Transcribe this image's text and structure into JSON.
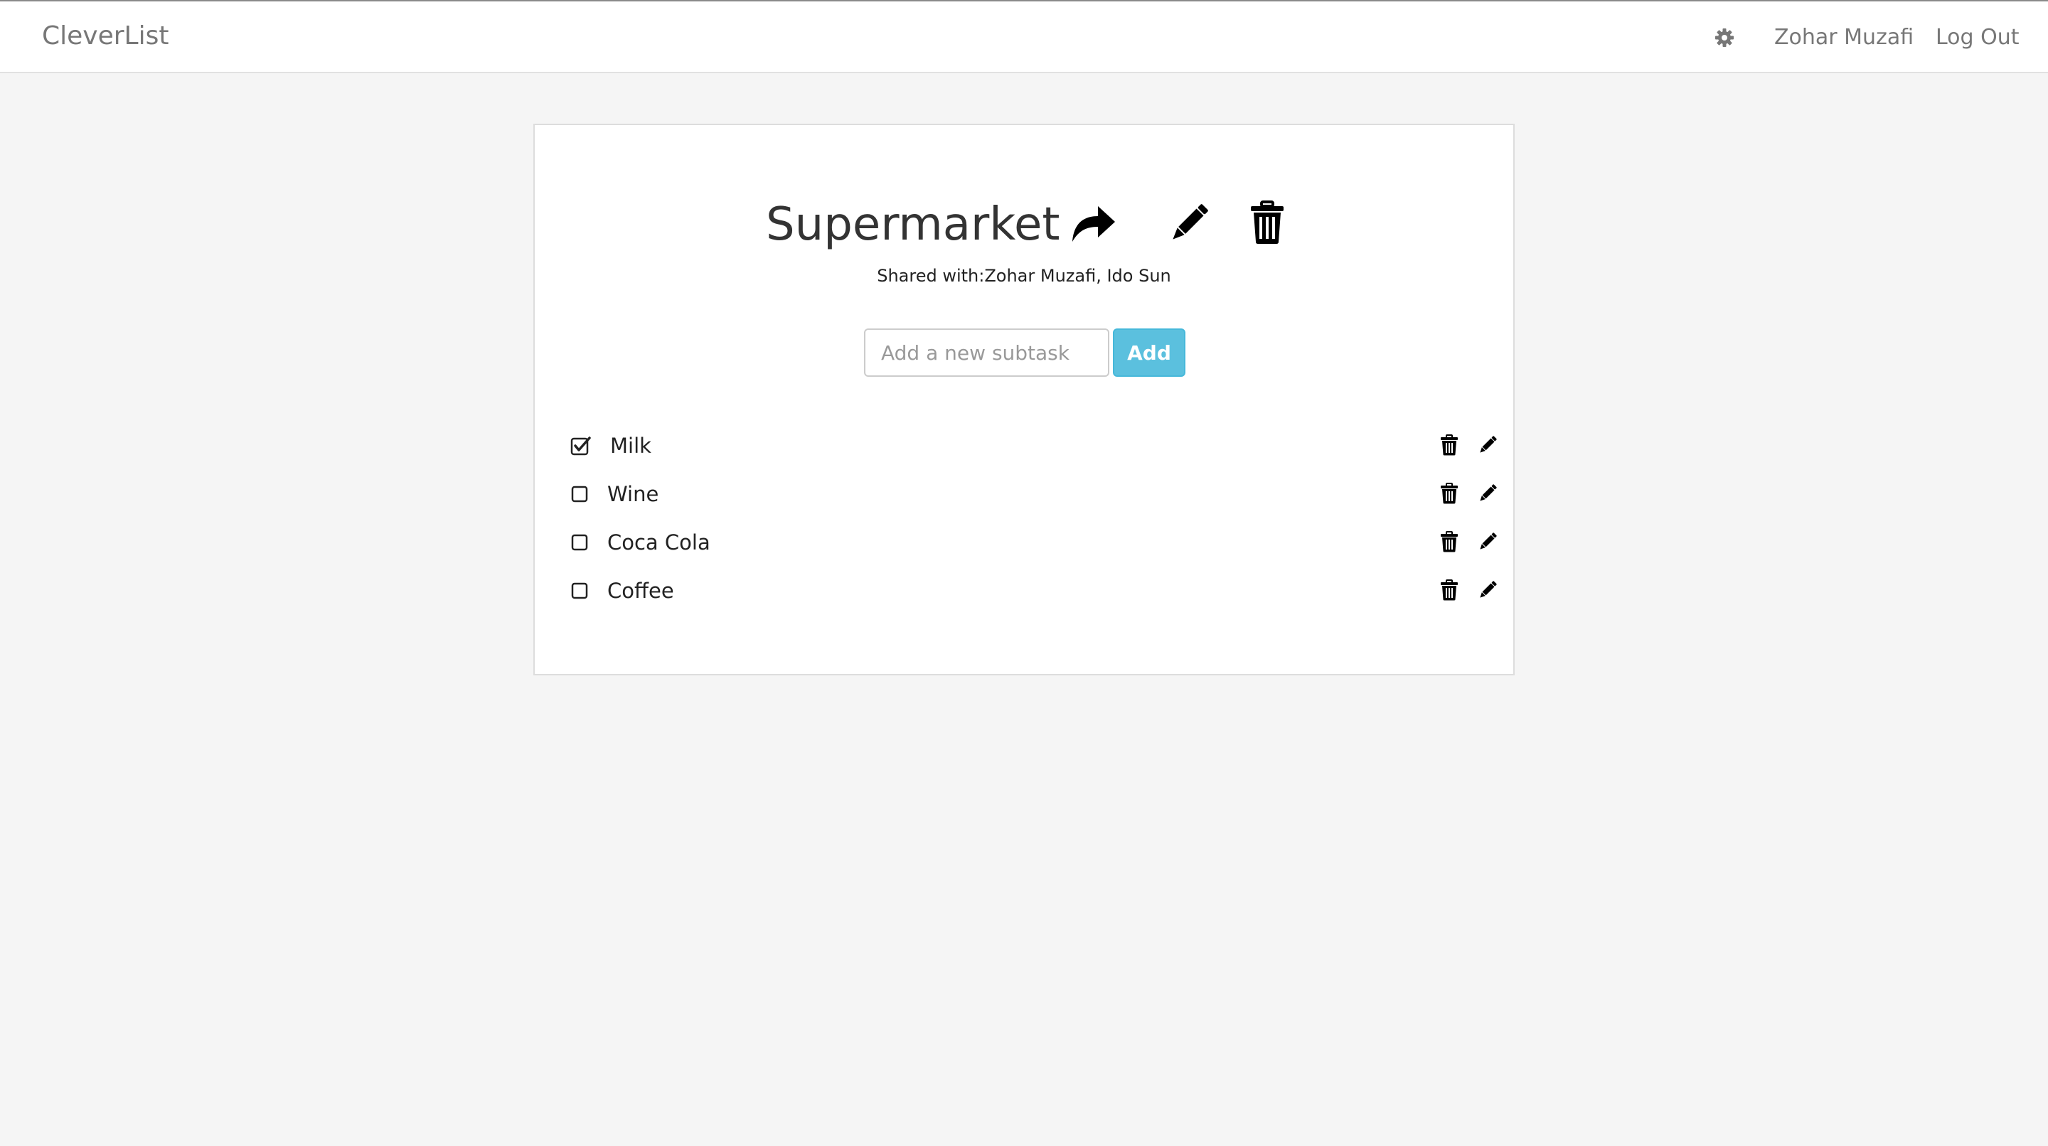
{
  "navbar": {
    "brand": "CleverList",
    "user_name": "Zohar Muzafi",
    "logout_label": "Log Out",
    "settings_icon": "gear-icon"
  },
  "list": {
    "title": "Supermarket",
    "shared_with": "Shared with:Zohar Muzafi, Ido Sun",
    "actions": [
      "share-icon",
      "pencil-icon",
      "trash-icon"
    ]
  },
  "new_subtask": {
    "placeholder": "Add a new subtask",
    "value": "",
    "add_label": "Add"
  },
  "subtasks": [
    {
      "label": "Milk",
      "checked": true
    },
    {
      "label": "Wine",
      "checked": false
    },
    {
      "label": "Coca Cola",
      "checked": false
    },
    {
      "label": "Coffee",
      "checked": false
    }
  ],
  "colors": {
    "background": "#f5f5f5",
    "navbar_text": "#777777",
    "add_button": "#5bc0de"
  }
}
